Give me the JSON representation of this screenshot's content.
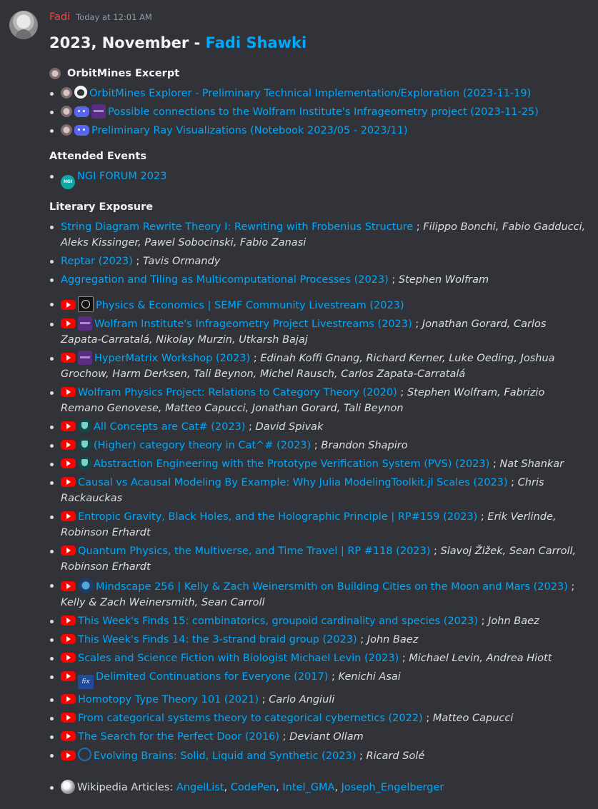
{
  "message": {
    "username": "Fadi",
    "timestamp": "Today at 12:01 AM",
    "title_prefix": "2023, November - ",
    "title_link": "Fadi Shawki"
  },
  "sections": {
    "orbitmines": {
      "heading": "OrbitMines Excerpt",
      "heading_icon": "orbitmines-icon",
      "items": [
        {
          "icons": [
            "orbitmines-icon",
            "github-icon"
          ],
          "title": "OrbitMines Explorer - Preliminary Technical Implementation/Exploration (2023-11-19)"
        },
        {
          "icons": [
            "orbitmines-icon",
            "discord-icon",
            "wolfram-institute-icon"
          ],
          "title": "Possible connections to the Wolfram Institute's Infrageometry project (2023-11-25)"
        },
        {
          "icons": [
            "orbitmines-icon",
            "discord-icon"
          ],
          "title": "Preliminary Ray Visualizations (Notebook 2023/05 - 2023/11)"
        }
      ]
    },
    "events": {
      "heading": "Attended Events",
      "items": [
        {
          "icons": [
            "ngi-icon"
          ],
          "icon_text": "NGI",
          "title": "NGI FORUM 2023"
        }
      ]
    },
    "literary": {
      "heading": "Literary Exposure",
      "papers": [
        {
          "title": "String Diagram Rewrite Theory I: Rewriting with Frobenius Structure",
          "authors": "Filippo Bonchi, Fabio Gadducci, Aleks Kissinger, Pawel Sobocinski, Fabio Zanasi"
        },
        {
          "title": "Reptar (2023)",
          "authors": "Tavis Ormandy"
        },
        {
          "title": "Aggregation and Tiling as Multicomputational Processes (2023)",
          "authors": "Stephen Wolfram"
        }
      ],
      "videos": [
        {
          "icons": [
            "youtube-icon",
            "semf-icon"
          ],
          "title": "Physics & Economics | SEMF Community Livestream (2023)",
          "authors": ""
        },
        {
          "icons": [
            "youtube-icon",
            "wolfram-institute-icon"
          ],
          "title": "Wolfram Institute's Infrageometry Project Livestreams (2023)",
          "authors": "Jonathan Gorard, Carlos Zapata-Carratalá, Nikolay Murzin, Utkarsh Bajaj"
        },
        {
          "icons": [
            "youtube-icon",
            "wolfram-institute-icon"
          ],
          "title": "HyperMatrix Workshop (2023)",
          "authors": "Edinah Koffi Gnang, Richard Kerner, Luke Oeding, Joshua Grochow, Harm Derksen, Tali Beynon, Michel Rausch, Carlos Zapata-Carratalá"
        },
        {
          "icons": [
            "youtube-icon"
          ],
          "title": "Wolfram Physics Project: Relations to Category Theory (2020)",
          "authors": "Stephen Wolfram, Fabrizio Remano Genovese, Matteo Capucci, Jonathan Gorard, Tali Beynon"
        },
        {
          "icons": [
            "youtube-icon",
            "shield-icon"
          ],
          "title": "All Concepts are Cat# (2023)",
          "authors": "David Spivak"
        },
        {
          "icons": [
            "youtube-icon",
            "shield-icon"
          ],
          "title": "(Higher) category theory in Cat^# (2023)",
          "authors": "Brandon Shapiro"
        },
        {
          "icons": [
            "youtube-icon",
            "shield-icon"
          ],
          "title": "Abstraction Engineering with the Prototype Verification System (PVS) (2023)",
          "authors": "Nat Shankar"
        },
        {
          "icons": [
            "youtube-icon"
          ],
          "title": "Causal vs Acausal Modeling By Example: Why Julia ModelingToolkit.jl Scales (2023)",
          "authors": "Chris Rackauckas"
        },
        {
          "icons": [
            "youtube-icon"
          ],
          "title": "Entropic Gravity, Black Holes, and the Holographic Principle | RP#159 (2023)",
          "authors": "Erik Verlinde, Robinson Erhardt"
        },
        {
          "icons": [
            "youtube-icon"
          ],
          "title": "Quantum Physics, the Multiverse, and Time Travel | RP #118 (2023)",
          "authors": "Slavoj Žižek, Sean Carroll, Robinson Erhardt"
        },
        {
          "icons": [
            "youtube-icon",
            "mindscape-icon"
          ],
          "title": "Mindscape 256 | Kelly & Zach Weinersmith on Building Cities on the Moon and Mars (2023)",
          "authors": "Kelly & Zach Weinersmith, Sean Carroll"
        },
        {
          "icons": [
            "youtube-icon"
          ],
          "title": "This Week's Finds 15: combinatorics, groupoid cardinality and species (2023)",
          "authors": "John Baez"
        },
        {
          "icons": [
            "youtube-icon"
          ],
          "title": "This Week's Finds 14: the 3-strand braid group (2023)",
          "authors": "John Baez"
        },
        {
          "icons": [
            "youtube-icon"
          ],
          "title": "Scales and Science Fiction with Biologist Michael Levin (2023)",
          "authors": "Michael Levin, Andrea Hiott"
        },
        {
          "icons": [
            "youtube-icon",
            "fix-icon"
          ],
          "title": "Delimited Continuations for Everyone (2017)",
          "authors": "Kenichi Asai"
        },
        {
          "icons": [
            "youtube-icon"
          ],
          "title": "Homotopy Type Theory 101 (2021)",
          "authors": "Carlo Angiuli"
        },
        {
          "icons": [
            "youtube-icon"
          ],
          "title": "From categorical systems theory to categorical cybernetics (2022)",
          "authors": "Matteo Capucci"
        },
        {
          "icons": [
            "youtube-icon"
          ],
          "title": "The Search for the Perfect Door (2016)",
          "authors": "Deviant Ollam"
        },
        {
          "icons": [
            "youtube-icon",
            "brain-icon"
          ],
          "title": "Evolving Brains: Solid, Liquid and Synthetic (2023)",
          "authors": "Ricard Solé"
        }
      ]
    },
    "wikipedia": {
      "label": "Wikipedia Articles: ",
      "icon": "wikipedia-icon",
      "articles": [
        "AngelList",
        "CodePen",
        "Intel_GMA",
        "Joseph_Engelberger"
      ]
    }
  },
  "separator": " ; ",
  "colors": {
    "background": "#313338",
    "link": "#00a8fc",
    "username": "#f04747",
    "youtube": "#ff0000"
  }
}
